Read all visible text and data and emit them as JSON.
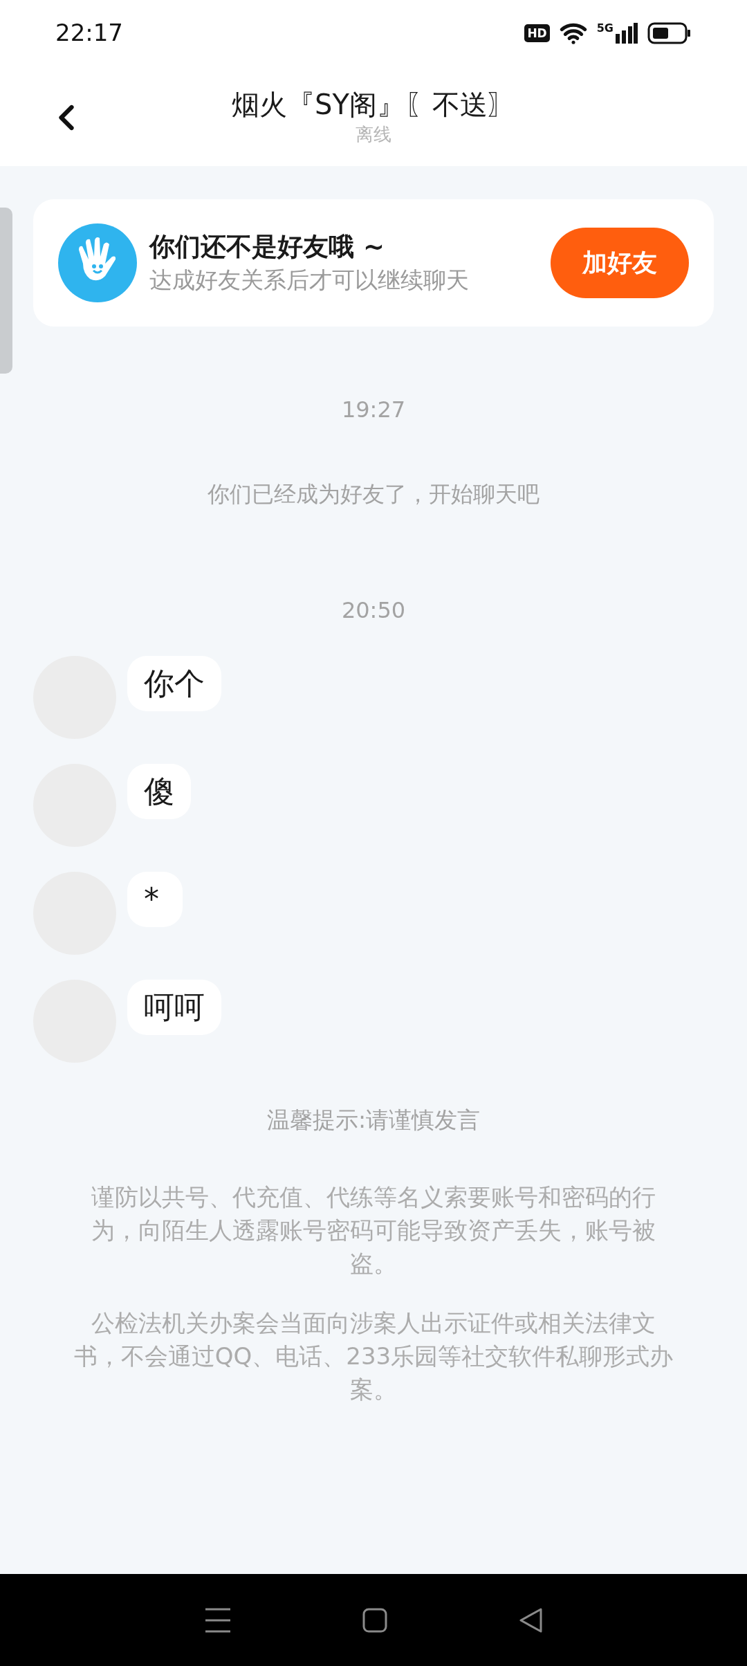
{
  "status_bar": {
    "time": "22:17",
    "hd_badge": "HD",
    "network": "5G"
  },
  "header": {
    "title": "烟火『SY阁』〖不送〗",
    "subtitle": "离线"
  },
  "friend_notice": {
    "title": "你们还不是好友哦 ~",
    "subtitle": "达成好友关系后才可以继续聊天",
    "button": "加好友"
  },
  "chat": [
    {
      "kind": "timestamp",
      "text": "19:27"
    },
    {
      "kind": "system",
      "text": "你们已经成为好友了，开始聊天吧"
    },
    {
      "kind": "timestamp",
      "text": "20:50"
    },
    {
      "kind": "message",
      "text": "你个"
    },
    {
      "kind": "message",
      "text": "傻"
    },
    {
      "kind": "message",
      "text": "*"
    },
    {
      "kind": "message",
      "text": "呵呵"
    }
  ],
  "tip": "温馨提示:请谨慎发言",
  "notices": [
    "谨防以共号、代充值、代练等名义索要账号和密码的行为，向陌生人透露账号密码可能导致资产丢失，账号被盗。",
    "公检法机关办案会当面向涉案人出示证件或相关法律文书，不会通过QQ、电话、233乐园等社交软件私聊形式办案。"
  ]
}
